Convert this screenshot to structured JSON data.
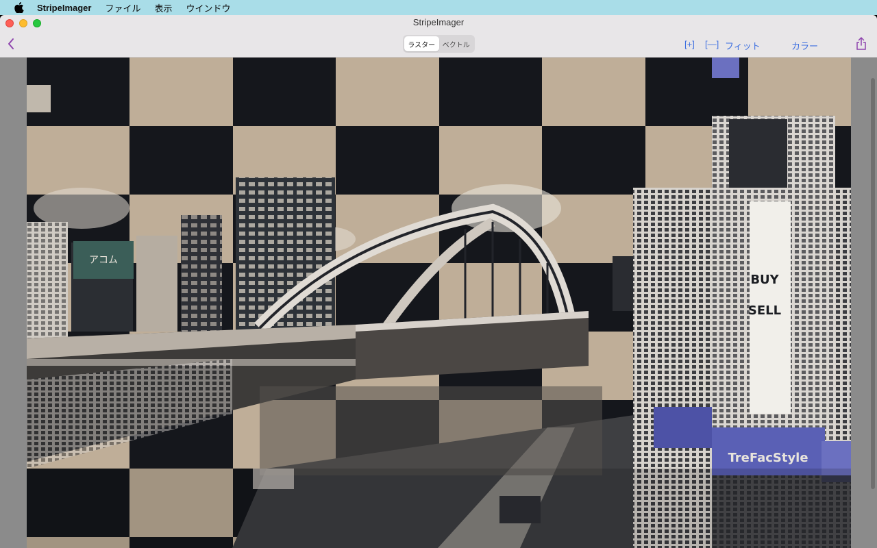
{
  "menubar": {
    "app_name": "StripeImager",
    "items": [
      "ファイル",
      "表示",
      "ウインドウ"
    ]
  },
  "window": {
    "title": "StripeImager"
  },
  "toolbar": {
    "segments": [
      "ラスター",
      "ベクトル"
    ],
    "selected_segment": "ラスター",
    "zoom_in_label": "[+]",
    "zoom_out_label": "[—]",
    "fit_label": "フィット",
    "color_label": "カラー"
  },
  "image": {
    "sign_text_1": "BUY",
    "sign_text_2": "SELL",
    "sign_text_3": "TreFacStyle",
    "sign_text_4": "アコム"
  },
  "colors": {
    "accent": "#3d6fe0",
    "back_chevron": "#8e44ad",
    "checker_dark": "#15171c",
    "checker_light": "#bfae98"
  }
}
